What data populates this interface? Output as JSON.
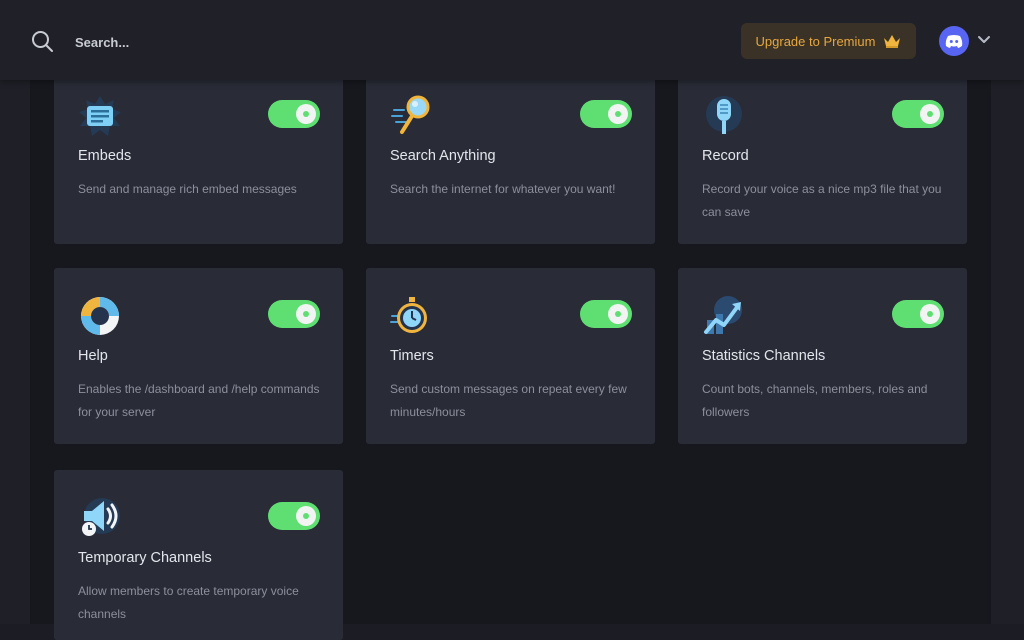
{
  "search": {
    "placeholder": "Search..."
  },
  "header": {
    "upgrade_label": "Upgrade to Premium"
  },
  "cards": [
    {
      "title": "Embeds",
      "description": "Send and manage rich embed messages",
      "enabled": true
    },
    {
      "title": "Search Anything",
      "description": "Search the internet for whatever you want!",
      "enabled": true
    },
    {
      "title": "Record",
      "description": "Record your voice as a nice mp3 file that you can save",
      "enabled": true
    },
    {
      "title": "Help",
      "description": "Enables the /dashboard and /help commands for your server",
      "enabled": true
    },
    {
      "title": "Timers",
      "description": "Send custom messages on repeat every few minutes/hours",
      "enabled": true
    },
    {
      "title": "Statistics Channels",
      "description": "Count bots, channels, members, roles and followers",
      "enabled": true
    },
    {
      "title": "Temporary Channels",
      "description": "Allow members to create temporary voice channels",
      "enabled": true
    }
  ],
  "colors": {
    "accent": "#5fdf72",
    "premium": "#e6a740",
    "discord": "#5865f2"
  }
}
